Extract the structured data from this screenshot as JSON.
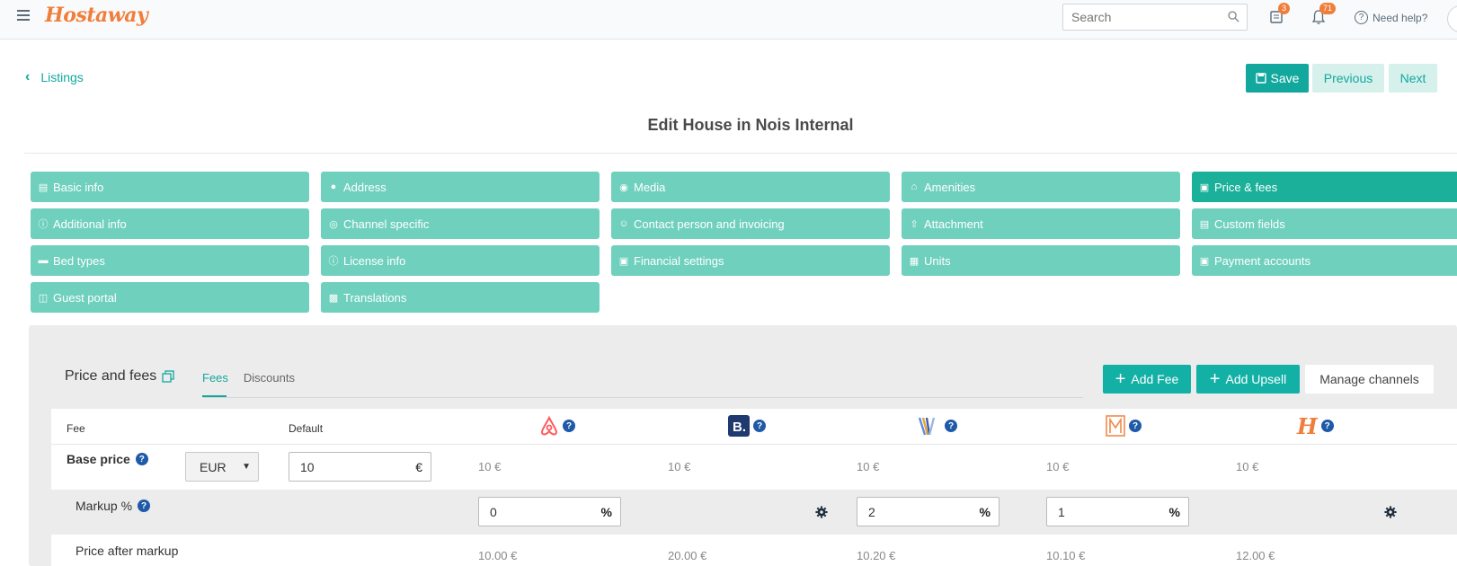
{
  "topbar": {
    "brand": "Hostaway",
    "search_placeholder": "Search",
    "messages_badge": "3",
    "notifications_badge": "71",
    "help_label": "Need help?"
  },
  "header": {
    "back_label": "Listings",
    "save_label": "Save",
    "previous_label": "Previous",
    "next_label": "Next",
    "title": "Edit House in Nois Internal"
  },
  "nav": {
    "items": [
      {
        "label": "Basic info",
        "icon": "id-card-icon",
        "active": false
      },
      {
        "label": "Address",
        "icon": "map-marker-icon",
        "active": false
      },
      {
        "label": "Media",
        "icon": "camera-icon",
        "active": false
      },
      {
        "label": "Amenities",
        "icon": "home-icon",
        "active": false
      },
      {
        "label": "Price & fees",
        "icon": "money-icon",
        "active": true
      },
      {
        "label": "Additional info",
        "icon": "info-icon",
        "active": false
      },
      {
        "label": "Channel specific",
        "icon": "target-icon",
        "active": false
      },
      {
        "label": "Contact person and invoicing",
        "icon": "user-icon",
        "active": false
      },
      {
        "label": "Attachment",
        "icon": "upload-icon",
        "active": false
      },
      {
        "label": "Custom fields",
        "icon": "id-card-icon",
        "active": false
      },
      {
        "label": "Bed types",
        "icon": "bed-icon",
        "active": false
      },
      {
        "label": "License info",
        "icon": "info-icon",
        "active": false
      },
      {
        "label": "Financial settings",
        "icon": "money-icon",
        "active": false
      },
      {
        "label": "Units",
        "icon": "building-icon",
        "active": false
      },
      {
        "label": "Payment accounts",
        "icon": "money-icon",
        "active": false
      },
      {
        "label": "Guest portal",
        "icon": "briefcase-icon",
        "active": false
      },
      {
        "label": "Translations",
        "icon": "language-icon",
        "active": false
      }
    ]
  },
  "section": {
    "title": "Price and fees",
    "tabs": [
      "Fees",
      "Discounts"
    ],
    "active_tab": "Fees",
    "add_fee_label": "Add Fee",
    "add_upsell_label": "Add Upsell",
    "manage_channels_label": "Manage channels"
  },
  "table": {
    "fee_header": "Fee",
    "default_header": "Default",
    "channels": [
      "airbnb-logo-icon",
      "booking-logo-icon",
      "vrbo-logo-icon",
      "marriott-logo-icon",
      "hostaway-logo-icon"
    ],
    "base_price": {
      "label": "Base price",
      "currency": "EUR",
      "default_value": "10",
      "default_suffix": "€",
      "channel_values": [
        "10 €",
        "10 €",
        "10 €",
        "10 €",
        "10 €"
      ]
    },
    "markup": {
      "label": "Markup %",
      "inputs": [
        "0",
        "2",
        "1"
      ],
      "suffix": "%"
    },
    "price_after_markup": {
      "label": "Price after markup",
      "values": [
        "10.00 €",
        "20.00 €",
        "10.20 €",
        "10.10 €",
        "12.00 €"
      ]
    }
  },
  "colors": {
    "accent": "#13a89e",
    "nav_button": "#6fd0bd",
    "nav_active": "#1ab09a",
    "brand_orange": "#f07e3a"
  }
}
